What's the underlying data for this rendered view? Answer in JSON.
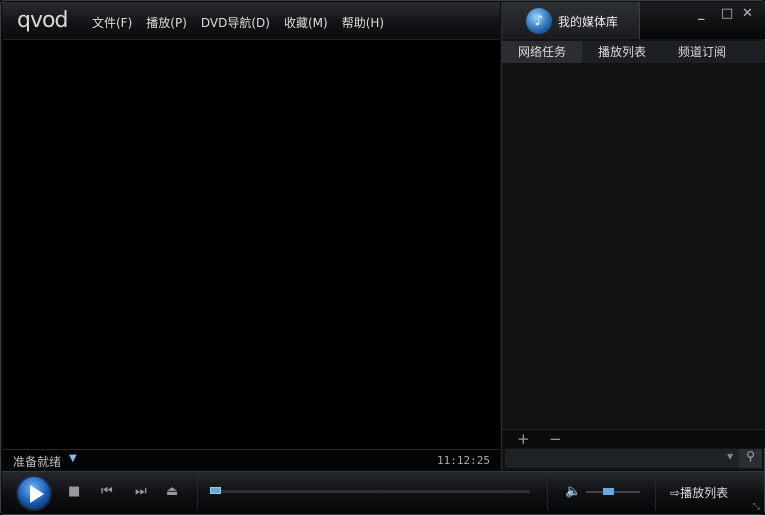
{
  "app": {
    "logo": "qvod"
  },
  "menu": [
    {
      "label": "文件(F)"
    },
    {
      "label": "播放(P)"
    },
    {
      "label": "DVD导航(D)"
    },
    {
      "label": "收藏(M)"
    },
    {
      "label": "帮助(H)"
    }
  ],
  "status": {
    "text": "准备就绪",
    "time": "11:12:25"
  },
  "library": {
    "title": "我的媒体库",
    "tabs": [
      "网络任务",
      "播放列表",
      "频道订阅"
    ],
    "active_tab": 0,
    "add": "+",
    "remove": "−",
    "search_value": ""
  },
  "window": {
    "minimize": "_",
    "maximize": "□",
    "close": "✕"
  },
  "controls": {
    "playlist_label": "播放列表",
    "progress": 0,
    "volume": 0.4
  },
  "colors": {
    "accent": "#6aa8e0"
  }
}
